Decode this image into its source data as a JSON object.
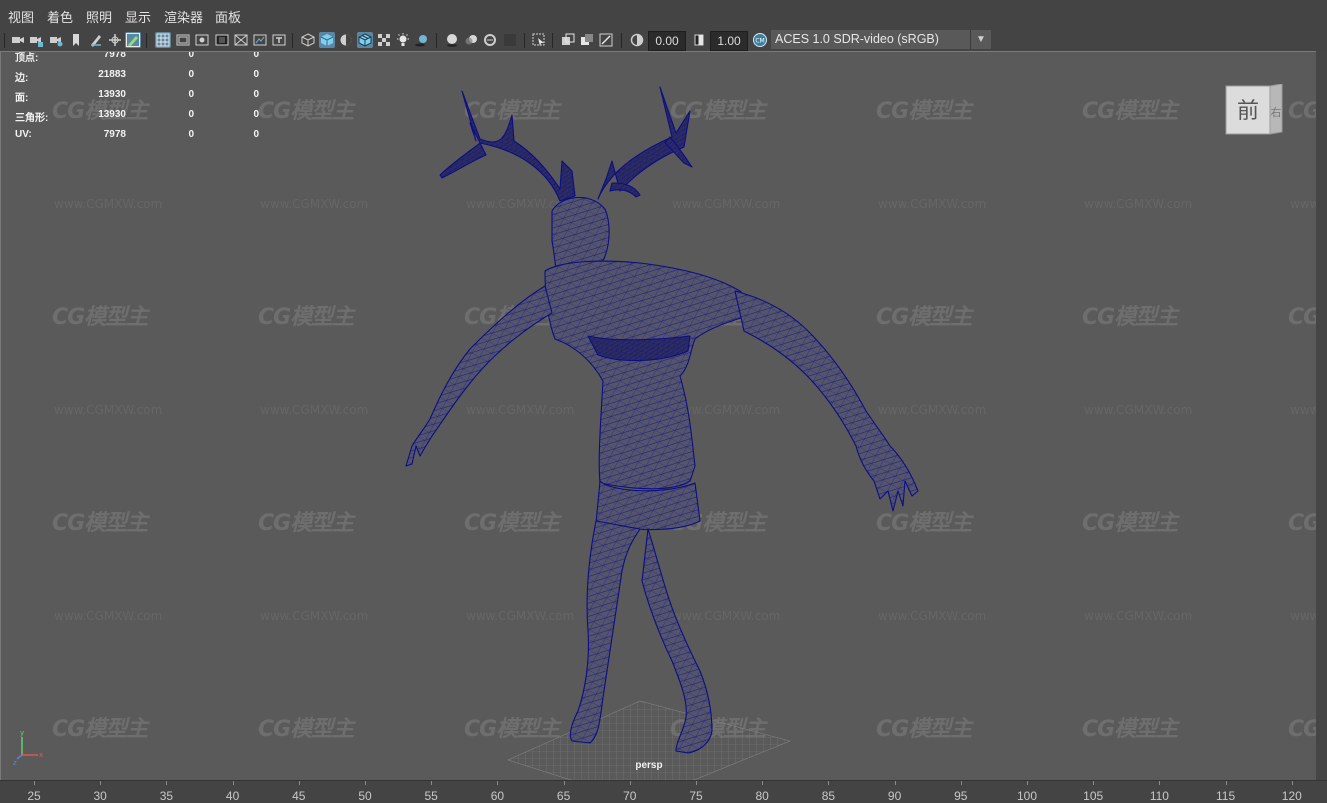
{
  "menu": [
    "视图",
    "着色",
    "照明",
    "显示",
    "渲染器",
    "面板"
  ],
  "toolbar": {
    "exposure_value": "0.00",
    "gamma_value": "1.00",
    "colorspace": "ACES 1.0 SDR-video (sRGB)"
  },
  "hud": [
    {
      "label": "顶点:",
      "v1": "7978",
      "v2": "0",
      "v3": "0"
    },
    {
      "label": "边:",
      "v1": "21883",
      "v2": "0",
      "v3": "0"
    },
    {
      "label": "面:",
      "v1": "13930",
      "v2": "0",
      "v3": "0"
    },
    {
      "label": "三角形:",
      "v1": "13930",
      "v2": "0",
      "v3": "0"
    },
    {
      "label": "UV:",
      "v1": "7978",
      "v2": "0",
      "v3": "0"
    }
  ],
  "viewcube": {
    "front_label": "前",
    "side_label": "右"
  },
  "camera_label": "persp",
  "watermark": {
    "logo": "CG模型主",
    "url": "www.CGMXW.com"
  },
  "timeline_ticks": [
    "25",
    "30",
    "35",
    "40",
    "45",
    "50",
    "55",
    "60",
    "65",
    "70",
    "75",
    "80",
    "85",
    "90",
    "95",
    "100",
    "105",
    "110",
    "115",
    "120"
  ],
  "colors": {
    "wireframe": "#0f0f8a",
    "viewport_bg": "#5a5a5a",
    "selected_button": "#5b87a3"
  }
}
